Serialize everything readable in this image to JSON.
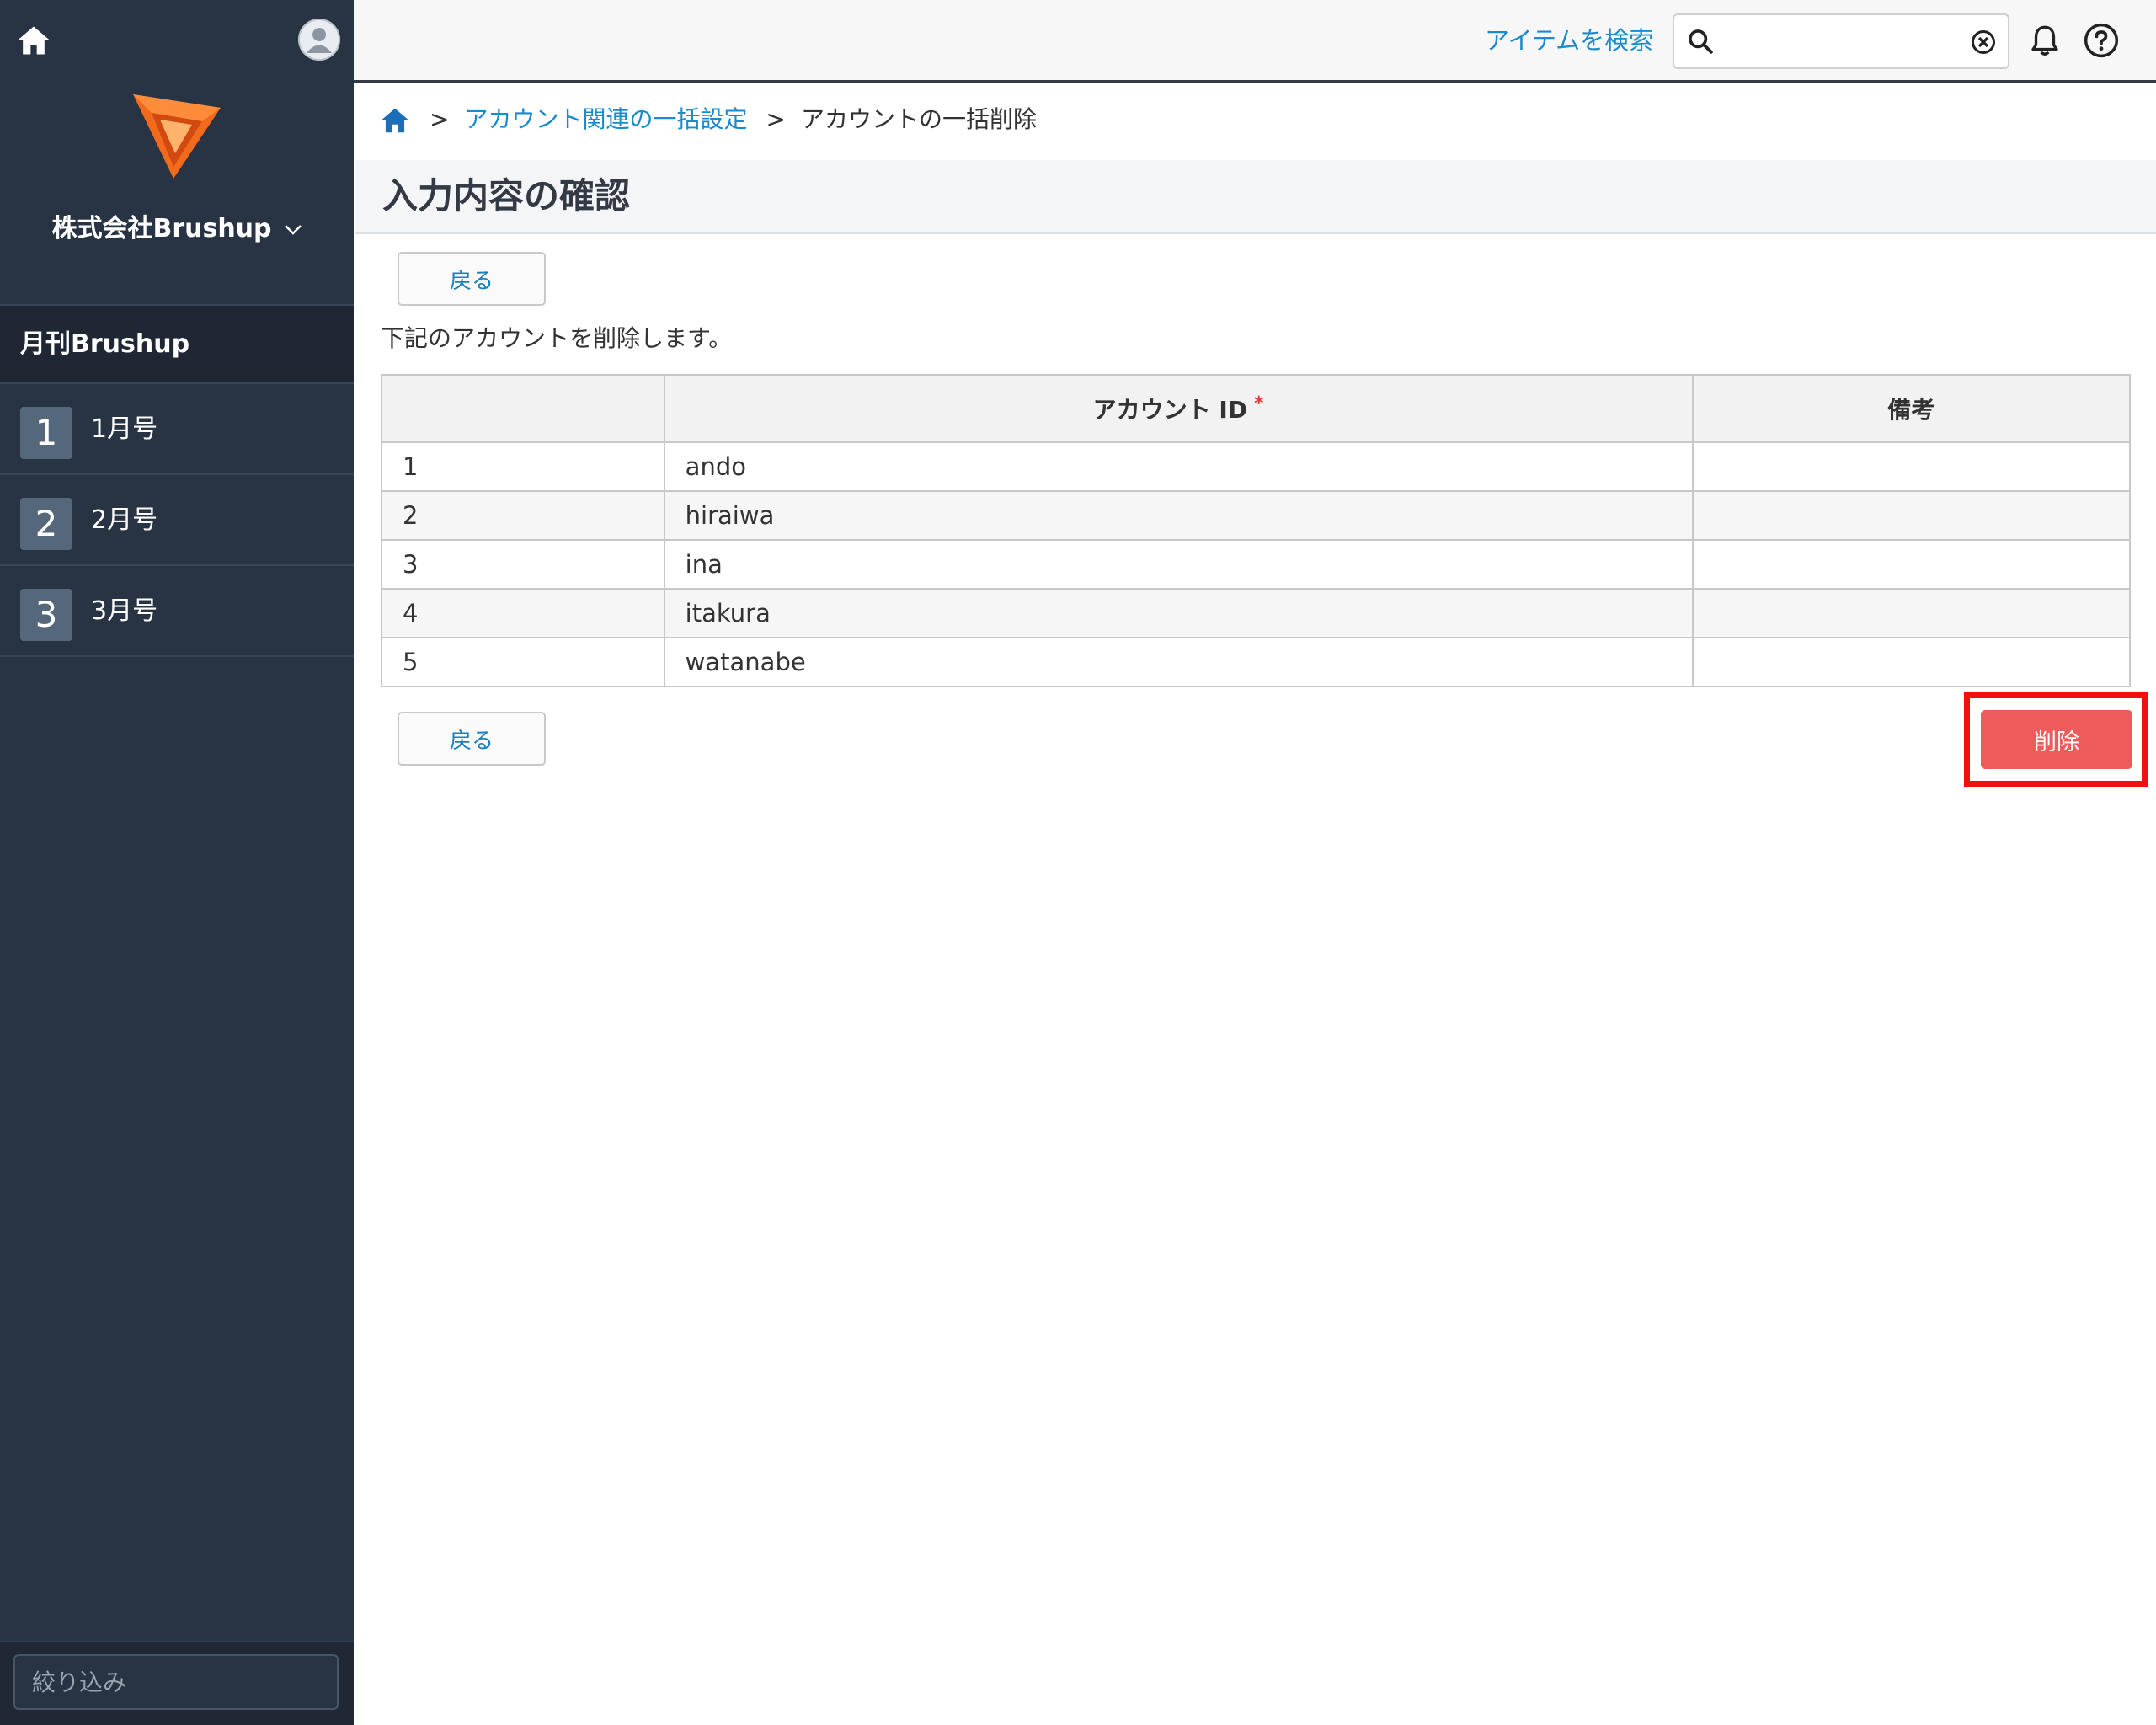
{
  "sidebar": {
    "company_name": "株式会社Brushup",
    "project_title": "月刊Brushup",
    "issues": [
      {
        "number": "1",
        "label": "1月号"
      },
      {
        "number": "2",
        "label": "2月号"
      },
      {
        "number": "3",
        "label": "3月号"
      }
    ],
    "filter_placeholder": "絞り込み"
  },
  "header": {
    "search_link": "アイテムを検索",
    "search_value": ""
  },
  "breadcrumb": {
    "parent": "アカウント関連の一括設定",
    "current": "アカウントの一括削除",
    "separator": ">"
  },
  "page": {
    "title": "入力内容の確認",
    "back_label": "戻る",
    "instruction": "下記のアカウントを削除します。",
    "delete_label": "削除"
  },
  "table": {
    "headers": [
      "",
      "アカウント ID",
      "備考"
    ],
    "required_mark": "*",
    "rows": [
      {
        "no": "1",
        "id": "ando",
        "note": ""
      },
      {
        "no": "2",
        "id": "hiraiwa",
        "note": ""
      },
      {
        "no": "3",
        "id": "ina",
        "note": ""
      },
      {
        "no": "4",
        "id": "itakura",
        "note": ""
      },
      {
        "no": "5",
        "id": "watanabe",
        "note": ""
      }
    ]
  },
  "colors": {
    "sidebar_bg": "#283344",
    "link": "#1a8bcc",
    "delete_button": "#ef5a5a",
    "highlight": "#f01010",
    "logo_orange": "#f26a1b"
  },
  "icons": [
    "home-icon",
    "user-avatar-icon",
    "brushup-logo",
    "chevron-down-icon",
    "search-icon",
    "clear-icon",
    "bell-icon",
    "help-icon"
  ]
}
